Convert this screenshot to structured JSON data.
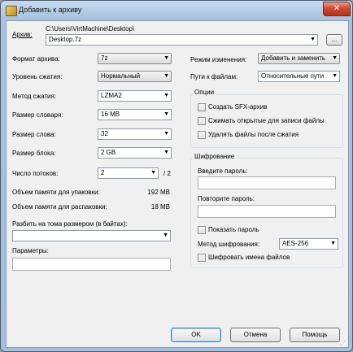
{
  "window": {
    "title": "Добавить к архиву",
    "close_glyph": "✕"
  },
  "archive": {
    "label": "Архив:",
    "path": "C:\\Users\\VirtMachine\\Desktop\\",
    "filename": "Desktop.7z",
    "browse_label": "..."
  },
  "left": {
    "format": {
      "label": "Формат архива:",
      "value": "7z"
    },
    "level": {
      "label": "Уровень сжатия:",
      "value": "Нормальный"
    },
    "method": {
      "label": "Метод сжатия:",
      "value": "LZMA2"
    },
    "dict": {
      "label": "Размер словаря:",
      "value": "16 MB"
    },
    "word": {
      "label": "Размер слова:",
      "value": "32"
    },
    "block": {
      "label": "Размер блока:",
      "value": "2 GB"
    },
    "threads": {
      "label": "Число потоков:",
      "value": "2",
      "max": "/ 2"
    },
    "mem_pack": {
      "label": "Объем памяти для упаковки:",
      "value": "192 MB"
    },
    "mem_unpack": {
      "label": "Объем памяти для распаковки:",
      "value": "18 MB"
    },
    "split": {
      "label": "Разбить на тома размером (в байтах):",
      "value": ""
    },
    "params": {
      "label": "Параметры:",
      "value": ""
    }
  },
  "right": {
    "update_mode": {
      "label": "Режим изменения:",
      "value": "Добавить и заменить"
    },
    "path_mode": {
      "label": "Пути к файлам:",
      "value": "Относительные пути"
    },
    "options": {
      "legend": "Опции",
      "sfx": "Создать SFX-архив",
      "shared": "Сжимать открытые для записи файлы",
      "delete": "Удалять файлы после сжатия"
    },
    "encryption": {
      "legend": "Шифрование",
      "password_label": "Введите пароль:",
      "repeat_label": "Повторите пароль:",
      "show_password": "Показать пароль",
      "method_label": "Метод шифрования:",
      "method_value": "AES-256",
      "encrypt_names": "Шифровать имена файлов"
    }
  },
  "buttons": {
    "ok": "OK",
    "cancel": "Отмена",
    "help": "Помощь"
  },
  "icons": {
    "dropdown_arrow": "▼"
  }
}
